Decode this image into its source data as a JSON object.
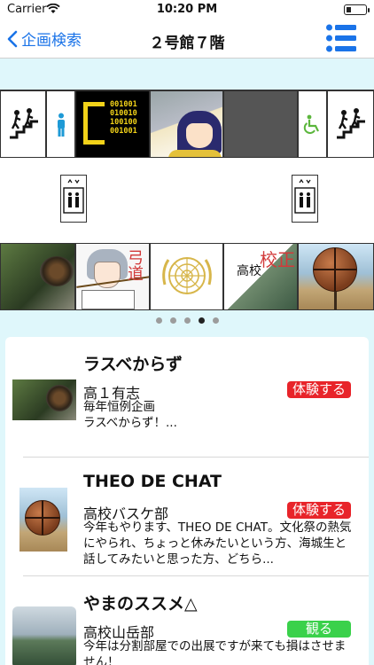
{
  "status_bar": {
    "carrier": "Carrier",
    "time": "10:20 PM"
  },
  "nav": {
    "back_label": "企画検索",
    "title": "２号館７階"
  },
  "floor_map": {
    "code_text": "001001\n010010\n100100\n001001",
    "kyudo_text": "弓道",
    "mountain_text": "校正",
    "mountain_sub": "高校",
    "pager": {
      "count": 5,
      "active_index": 3
    }
  },
  "events": [
    {
      "name": "ラスベからず",
      "org": "高１有志",
      "badge": "体験する",
      "badge_color": "#e8242a",
      "description": "毎年恒例企画\nラスベからず！..."
    },
    {
      "name": "THEO DE CHAT",
      "org": "高校バスケ部",
      "badge": "体験する",
      "badge_color": "#e8242a",
      "description": "今年もやります、THEO DE CHAT。文化祭の熱気にやられ、ちょっと休みたいという方、海城生と話してみたいと思った方、どちら..."
    },
    {
      "name": "やまのススメ△",
      "org": "高校山岳部",
      "badge": "観る",
      "badge_color": "#3ad14b",
      "description": "今年は分割部屋での出展ですが来ても損はさせません！"
    }
  ],
  "colors": {
    "accent": "#1a73e8",
    "background": "#dff7fb"
  }
}
